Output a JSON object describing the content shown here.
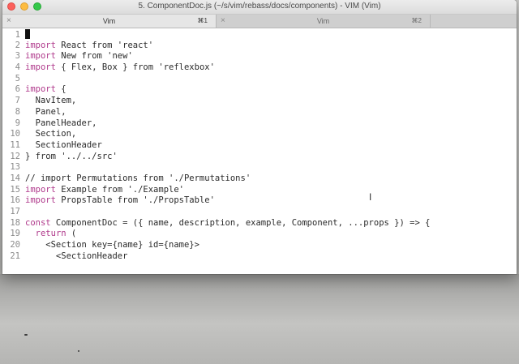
{
  "window": {
    "title": "5. ComponentDoc.js (~/s/vim/rebass/docs/components) - VIM (Vim)"
  },
  "tabs": [
    {
      "close": "×",
      "label": "Vim",
      "shortcut": "⌘1",
      "active": true
    },
    {
      "close": "×",
      "label": "Vim",
      "shortcut": "⌘2",
      "active": false
    }
  ],
  "editor": {
    "lines": [
      {
        "n": "1",
        "tokens": []
      },
      {
        "n": "2",
        "tokens": [
          {
            "t": "kw",
            "v": "import"
          },
          {
            "t": "txt",
            "v": " React from 'react'"
          }
        ]
      },
      {
        "n": "3",
        "tokens": [
          {
            "t": "kw",
            "v": "import"
          },
          {
            "t": "txt",
            "v": " New from 'new'"
          }
        ]
      },
      {
        "n": "4",
        "tokens": [
          {
            "t": "kw",
            "v": "import"
          },
          {
            "t": "txt",
            "v": " { Flex, Box } from 'reflexbox'"
          }
        ]
      },
      {
        "n": "5",
        "tokens": []
      },
      {
        "n": "6",
        "tokens": [
          {
            "t": "kw",
            "v": "import"
          },
          {
            "t": "txt",
            "v": " {"
          }
        ]
      },
      {
        "n": "7",
        "tokens": [
          {
            "t": "txt",
            "v": "  NavItem,"
          }
        ]
      },
      {
        "n": "8",
        "tokens": [
          {
            "t": "txt",
            "v": "  Panel,"
          }
        ]
      },
      {
        "n": "9",
        "tokens": [
          {
            "t": "txt",
            "v": "  PanelHeader,"
          }
        ]
      },
      {
        "n": "10",
        "tokens": [
          {
            "t": "txt",
            "v": "  Section,"
          }
        ]
      },
      {
        "n": "11",
        "tokens": [
          {
            "t": "txt",
            "v": "  SectionHeader"
          }
        ]
      },
      {
        "n": "12",
        "tokens": [
          {
            "t": "txt",
            "v": "} from '../../src'"
          }
        ]
      },
      {
        "n": "13",
        "tokens": []
      },
      {
        "n": "14",
        "tokens": [
          {
            "t": "txt",
            "v": "// import Permutations from './Permutations'"
          }
        ]
      },
      {
        "n": "15",
        "tokens": [
          {
            "t": "kw",
            "v": "import"
          },
          {
            "t": "txt",
            "v": " Example from './Example'"
          }
        ]
      },
      {
        "n": "16",
        "tokens": [
          {
            "t": "kw",
            "v": "import"
          },
          {
            "t": "txt",
            "v": " PropsTable from './PropsTable'"
          }
        ]
      },
      {
        "n": "17",
        "tokens": []
      },
      {
        "n": "18",
        "tokens": [
          {
            "t": "kw",
            "v": "const"
          },
          {
            "t": "txt",
            "v": " ComponentDoc = ({ name, description, example, Component, ...props }) => {"
          }
        ]
      },
      {
        "n": "19",
        "tokens": [
          {
            "t": "txt",
            "v": "  "
          },
          {
            "t": "kw",
            "v": "return"
          },
          {
            "t": "txt",
            "v": " ("
          }
        ]
      },
      {
        "n": "20",
        "tokens": [
          {
            "t": "txt",
            "v": "    <Section key={name} id={name}>"
          }
        ]
      },
      {
        "n": "21",
        "tokens": [
          {
            "t": "txt",
            "v": "      <SectionHeader"
          }
        ]
      }
    ]
  },
  "colors": {
    "keyword": "#b03a8c",
    "line_number": "#8a8a8a",
    "text": "#2a2a2a"
  }
}
